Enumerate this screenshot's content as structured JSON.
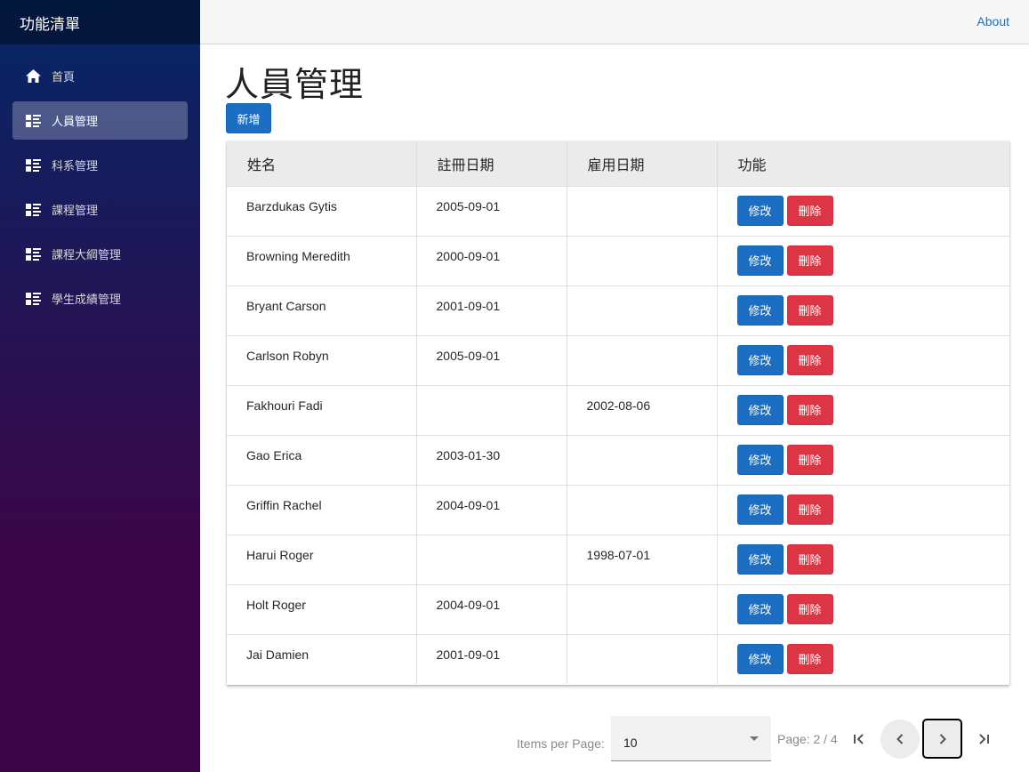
{
  "sidebar": {
    "brand": "功能清單",
    "items": [
      {
        "label": "首頁",
        "icon": "home-icon"
      },
      {
        "label": "人員管理",
        "icon": "list-icon",
        "active": true
      },
      {
        "label": "科系管理",
        "icon": "list-icon"
      },
      {
        "label": "課程管理",
        "icon": "list-icon"
      },
      {
        "label": "課程大綱管理",
        "icon": "list-icon"
      },
      {
        "label": "學生成績管理",
        "icon": "list-icon"
      }
    ]
  },
  "topbar": {
    "about": "About"
  },
  "page": {
    "title": "人員管理",
    "add_label": "新增"
  },
  "table": {
    "headers": [
      "姓名",
      "註冊日期",
      "雇用日期",
      "功能"
    ],
    "edit_label": "修改",
    "delete_label": "刪除",
    "rows": [
      [
        "Barzdukas Gytis",
        "2005-09-01",
        ""
      ],
      [
        "Browning Meredith",
        "2000-09-01",
        ""
      ],
      [
        "Bryant Carson",
        "2001-09-01",
        ""
      ],
      [
        "Carlson Robyn",
        "2005-09-01",
        ""
      ],
      [
        "Fakhouri Fadi",
        "",
        "2002-08-06"
      ],
      [
        "Gao Erica",
        "2003-01-30",
        ""
      ],
      [
        "Griffin Rachel",
        "2004-09-01",
        ""
      ],
      [
        "Harui Roger",
        "",
        "1998-07-01"
      ],
      [
        "Holt Roger",
        "2004-09-01",
        ""
      ],
      [
        "Jai Damien",
        "2001-09-01",
        ""
      ]
    ]
  },
  "pager": {
    "items_per_page_label": "Items per Page:",
    "items_per_page": "10",
    "page_info": "Page: 2 / 4"
  },
  "colors": {
    "primary": "#1b6ec2",
    "danger": "#dc3545"
  }
}
